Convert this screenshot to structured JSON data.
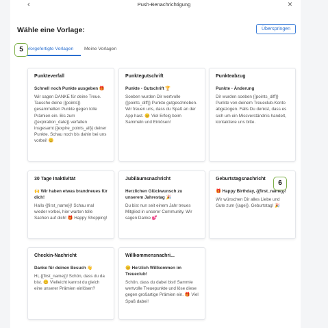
{
  "header": {
    "title": "Push-Benachrichtigung",
    "back_icon": "‹",
    "close_icon": "×"
  },
  "main": {
    "heading": "Wähle eine Vorlage:",
    "skip_label": "Überspringen",
    "tabs": [
      {
        "label": "Vorgefertigte Vorlagen",
        "active": true
      },
      {
        "label": "Meine Vorlagen",
        "active": false
      }
    ],
    "badges": [
      "5",
      "6"
    ]
  },
  "cards": [
    {
      "title": "Punkteverfall",
      "subtitle": "Schnell noch Punkte ausgeben 🎁",
      "body": "Wir sagen DANKE für deine Treue. Tausche deine {{points}} gesammelten Punkte gegen tolle Prämien ein. Bis zum {{expiration_date}} verfallen insgesamt {{expire_points_all}} deiner Punkte. Schau noch bis dahin bei uns vorbei! 😊"
    },
    {
      "title": "Punktegutschrift",
      "subtitle": "Punkte - Gutschrift 🏆",
      "body": "Soeben wurden Dir wertvolle {{points_diff}} Punkte gutgeschrieben. Wir freuen uns, dass du Spaß an der App hast. 😊 Viel Erfolg beim Sammeln und Einlösen!"
    },
    {
      "title": "Punkteabzug",
      "subtitle": "Punkte - Änderung",
      "body": "Dir wurden soeben {{points_diff}} Punkte von deinem Treueclub-Konto abgezogen. Falls Du denkst, dass es sich um ein Missverständnis handelt, kontaktiere uns bitte."
    },
    {
      "title": "30 Tage Inaktivität",
      "subtitle": "🙌 Wir haben etwas brandneues für dich!",
      "body": "Hallo {{first_name}}! Schau mal wieder vorbei, hier warten tolle Sachen auf dich! 🎁 Happy Shopping!"
    },
    {
      "title": "Jubiläumsnachricht",
      "subtitle": "Herzlichen Glückwunsch zu unserem Jahrestag 🎉",
      "body": "Du bist nun seit einem Jahr treues Mitglied in unserer Community. Wir sagen Danke 💕"
    },
    {
      "title": "Geburtstagsnachricht",
      "subtitle": "🎁 Happy Birthday, {{first_name}}!",
      "body": "Wir wünschen Dir alles Liebe und Gute zum {{age}}. Geburtstag! 🎉"
    },
    {
      "title": "Checkin-Nachricht",
      "subtitle": "Danke für deinen Besuch 👋",
      "body": "Hi, {{first_name}}! Schön, dass du da bist. 😊 Vielleicht kannst du gleich eine unserer Prämien einlösen?"
    },
    {
      "title": "Willkommensnachri...",
      "subtitle": "😊 Herzlich Willkommen im Treueclub!",
      "body": "Schön, dass du dabei bist! Sammle wertvolle Treuepunkte und löse diese gegen großartige Prämien ein. 🎁 Viel Spaß dabei!"
    }
  ]
}
